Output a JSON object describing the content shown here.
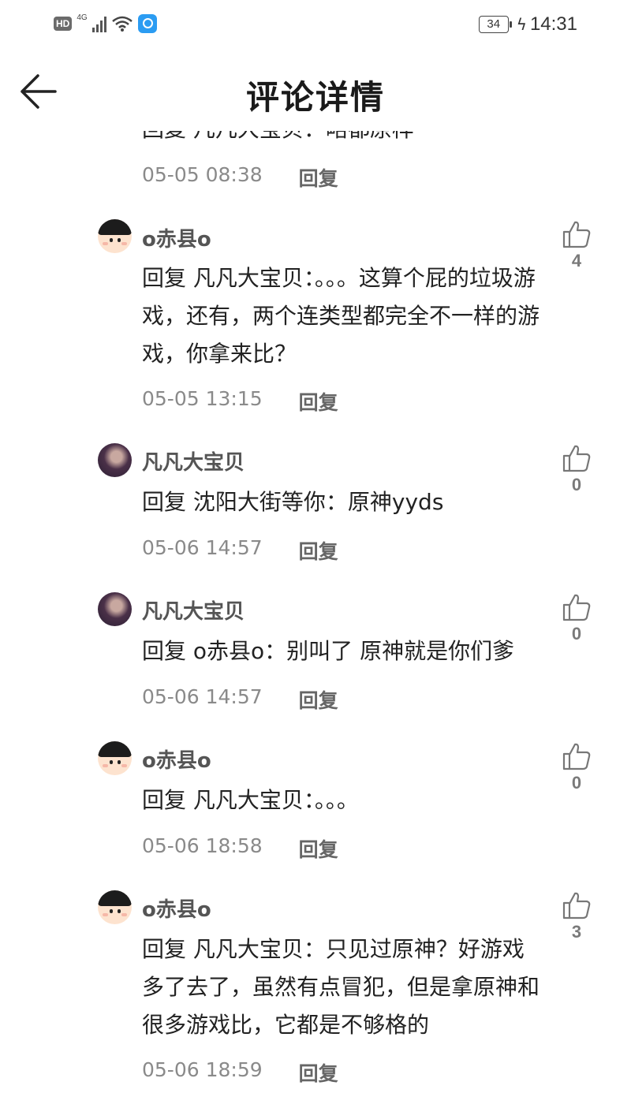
{
  "status_bar": {
    "hd": "HD",
    "network": "4G",
    "battery": "34",
    "time": "14:31"
  },
  "header": {
    "title": "评论详情"
  },
  "partial_previous": {
    "text": "回复 凡凡大宝贝：略都原样",
    "time": "05-05 08:38",
    "reply_label": "回复"
  },
  "comments": [
    {
      "user": "o赤县o",
      "avatar": "cartoon-boy",
      "text": "回复 凡凡大宝贝：。。。这算个屁的垃圾游戏，还有，两个连类型都完全不一样的游戏，你拿来比？",
      "time": "05-05 13:15",
      "reply_label": "回复",
      "likes": "4"
    },
    {
      "user": "凡凡大宝贝",
      "avatar": "photo-girl",
      "text": "回复 沈阳大街等你：原神yyds",
      "time": "05-06 14:57",
      "reply_label": "回复",
      "likes": "0"
    },
    {
      "user": "凡凡大宝贝",
      "avatar": "photo-girl",
      "text": "回复 o赤县o：别叫了 原神就是你们爹",
      "time": "05-06 14:57",
      "reply_label": "回复",
      "likes": "0"
    },
    {
      "user": "o赤县o",
      "avatar": "cartoon-boy",
      "text": "回复 凡凡大宝贝：。。。",
      "time": "05-06 18:58",
      "reply_label": "回复",
      "likes": "0"
    },
    {
      "user": "o赤县o",
      "avatar": "cartoon-boy",
      "text": "回复 凡凡大宝贝：只见过原神？好游戏多了去了，虽然有点冒犯，但是拿原神和很多游戏比，它都是不够格的",
      "time": "05-06 18:59",
      "reply_label": "回复",
      "likes": "3"
    }
  ],
  "colors": {
    "text": "#222222",
    "muted": "#8a8a8a",
    "username": "#555555"
  }
}
